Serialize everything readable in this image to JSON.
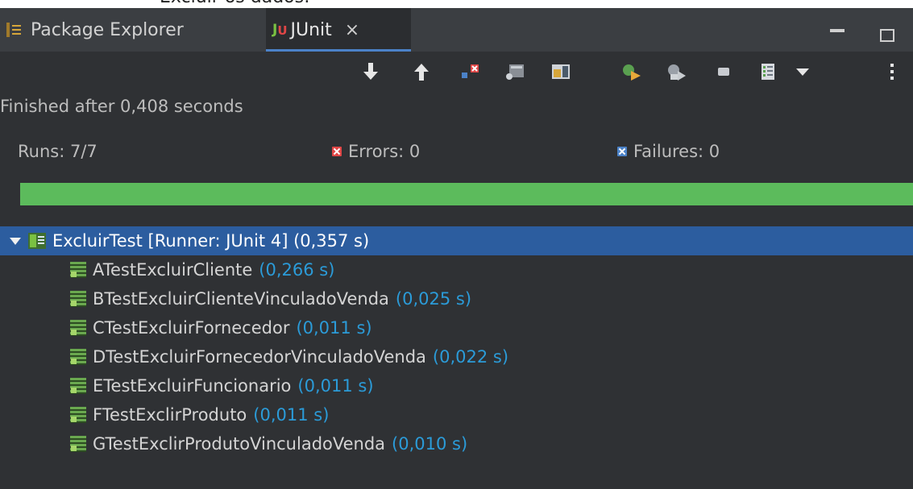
{
  "top_clip_text": "Excluir os dados:",
  "tabs": [
    {
      "label": "Package Explorer",
      "icon": "package-explorer-icon",
      "active": false
    },
    {
      "label": "JUnit",
      "icon": "junit-icon",
      "active": true,
      "close": "×"
    }
  ],
  "toolbar": {
    "icons": [
      "next-failure-icon",
      "previous-failure-icon",
      "show-failures-only-icon",
      "scroll-lock-icon",
      "show-skipped-icon",
      "rerun-icon",
      "rerun-failed-first-icon",
      "stop-icon",
      "test-run-history-icon",
      "view-menu-icon",
      "more-options-icon"
    ]
  },
  "status": "Finished after 0,408 seconds",
  "counters": {
    "runs": "Runs:  7/7",
    "errors": "Errors:  0",
    "failures": "Failures:  0"
  },
  "progress": {
    "fraction": 1.0,
    "color": "#5cbb5c"
  },
  "tree": {
    "root": {
      "label": "ExcluirTest [Runner: JUnit 4] (0,357 s)"
    },
    "cases": [
      {
        "name": "ATestExcluirCliente",
        "time": "(0,266 s)"
      },
      {
        "name": "BTestExcluirClienteVinculadoVenda",
        "time": "(0,025 s)"
      },
      {
        "name": "CTestExcluirFornecedor",
        "time": "(0,011 s)"
      },
      {
        "name": "DTestExcluirFornecedorVinculadoVenda",
        "time": "(0,022 s)"
      },
      {
        "name": "ETestExcluirFuncionario",
        "time": "(0,011 s)"
      },
      {
        "name": "FTestExclirProduto",
        "time": "(0,011 s)"
      },
      {
        "name": "GTestExclirProdutoVinculadoVenda",
        "time": "(0,010 s)"
      }
    ]
  },
  "colors": {
    "background": "#2f3134",
    "selection": "#2c5d9f",
    "time_text": "#2b9bd8",
    "error": "#e04646",
    "failure": "#4b82c8"
  }
}
